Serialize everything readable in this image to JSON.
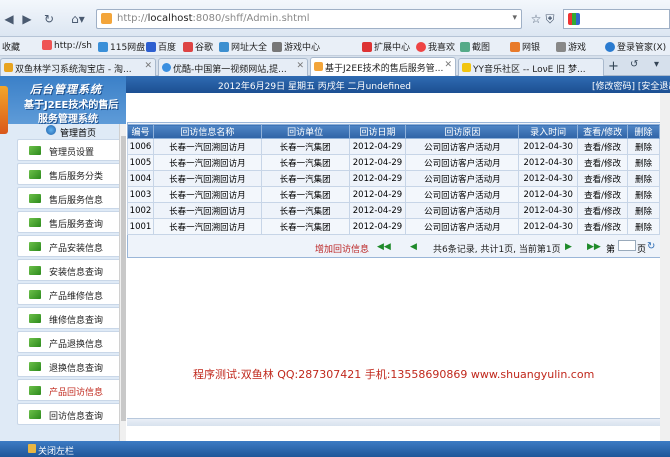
{
  "browser": {
    "url_prefix": "http://",
    "url_host": "localhost",
    "url_rest": ":8080/shff/Admin.shtml",
    "bookmarks": [
      "收藏",
      "http://sh",
      "115网盘",
      "百度",
      "谷歌",
      "网址大全",
      "游戏中心",
      "扩展中心",
      "我喜欢",
      "截图",
      "网银",
      "游戏",
      "登录管家(X)"
    ],
    "tabs": [
      {
        "label": "双鱼林学习系统淘宝店 - 淘..."
      },
      {
        "label": "优酷-中国第一视频网站,提..."
      },
      {
        "label": "基于J2EE技术的售后服务管..."
      },
      {
        "label": "YY音乐社区 -- LoνE 旧 梦..."
      }
    ]
  },
  "header": {
    "date": "2012年6月29日 星期五 丙戌年 二月undefined",
    "links": "[修改密码] [安全退出]"
  },
  "brand": {
    "title": "后台管理系统",
    "subtitle1": "基于J2EE技术的售后",
    "subtitle2": "服务管理系统"
  },
  "sidebar": {
    "head": "管理首页",
    "items": [
      {
        "label": "管理员设置"
      },
      {
        "label": "售后服务分类"
      },
      {
        "label": "售后服务信息"
      },
      {
        "label": "售后服务查询"
      },
      {
        "label": "产品安装信息"
      },
      {
        "label": "安装信息查询"
      },
      {
        "label": "产品维修信息"
      },
      {
        "label": "维修信息查询"
      },
      {
        "label": "产品退换信息"
      },
      {
        "label": "退换信息查询"
      },
      {
        "label": "产品回访信息"
      },
      {
        "label": "回访信息查询"
      }
    ]
  },
  "table": {
    "columns": [
      "编号",
      "回访信息名称",
      "回访单位",
      "回访日期",
      "回访原因",
      "录入时间",
      "查看/修改",
      "删除"
    ],
    "rows": [
      [
        "1006",
        "长春一汽回溯回访月",
        "长春一汽集团",
        "2012-04-29",
        "公司回访客户活动月",
        "2012-04-30",
        "查看/修改",
        "删除"
      ],
      [
        "1005",
        "长春一汽回溯回访月",
        "长春一汽集团",
        "2012-04-29",
        "公司回访客户活动月",
        "2012-04-30",
        "查看/修改",
        "删除"
      ],
      [
        "1004",
        "长春一汽回溯回访月",
        "长春一汽集团",
        "2012-04-29",
        "公司回访客户活动月",
        "2012-04-30",
        "查看/修改",
        "删除"
      ],
      [
        "1003",
        "长春一汽回溯回访月",
        "长春一汽集团",
        "2012-04-29",
        "公司回访客户活动月",
        "2012-04-30",
        "查看/修改",
        "删除"
      ],
      [
        "1002",
        "长春一汽回溯回访月",
        "长春一汽集团",
        "2012-04-29",
        "公司回访客户活动月",
        "2012-04-30",
        "查看/修改",
        "删除"
      ],
      [
        "1001",
        "长春一汽回溯回访月",
        "长春一汽集团",
        "2012-04-29",
        "公司回访客户活动月",
        "2012-04-30",
        "查看/修改",
        "删除"
      ]
    ]
  },
  "pager": {
    "add_label": "增加回访信息",
    "info": "共6条记录, 共计1页, 当前第1页",
    "page_label": "第",
    "page_suffix": "页"
  },
  "footer": {
    "text": "程序测试:双鱼林 QQ:287307421 手机:13558690869 www.shuangyulin.com"
  },
  "bottom": {
    "close_left": "关闭左栏"
  }
}
